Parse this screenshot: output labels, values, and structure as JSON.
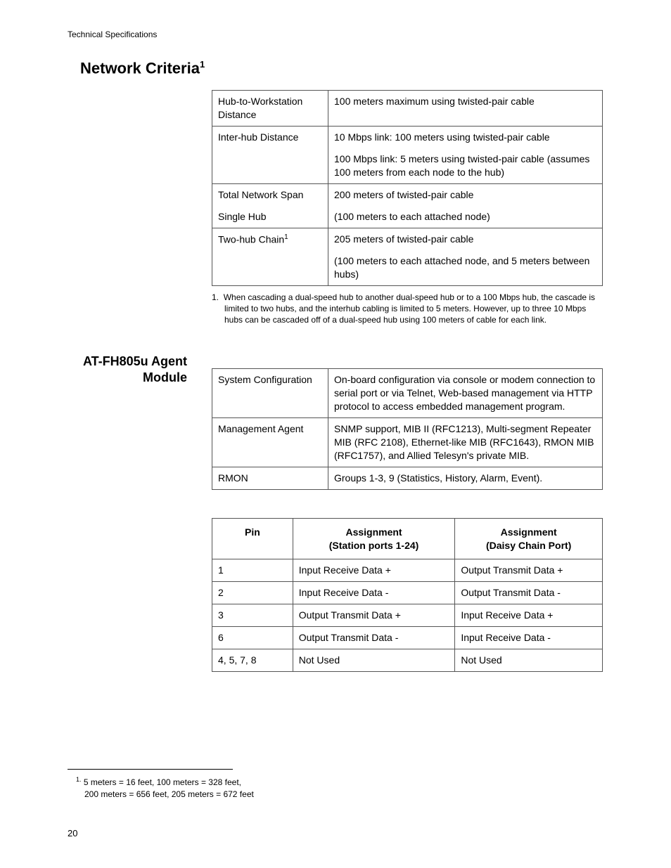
{
  "header": "Technical Specifications",
  "section1": {
    "title": "Network Criteria",
    "title_sup": "1"
  },
  "table1": {
    "rows": [
      {
        "label": "Hub-to-Workstation Distance",
        "value": "100 meters maximum using twisted-pair cable"
      },
      {
        "label": "Inter-hub Distance",
        "value": "10 Mbps link: 100 meters using twisted-pair cable"
      },
      {
        "label": "",
        "value": "100 Mbps link: 5 meters using twisted-pair cable (assumes 100 meters from each node to the hub)"
      },
      {
        "label": "Total Network Span",
        "value": "200 meters of twisted-pair cable"
      },
      {
        "label": "Single Hub",
        "value": "(100 meters to each attached node)"
      },
      {
        "label": "Two-hub Chain",
        "label_sup": "1",
        "value": "205 meters of twisted-pair cable"
      },
      {
        "label": "",
        "value": "(100 meters to each attached node, and 5 meters between hubs)"
      }
    ],
    "note_num": "1.",
    "note": "When cascading a dual-speed hub to another dual-speed hub or to a 100 Mbps hub, the cascade is limited to two hubs, and the interhub cabling is limited to 5 meters. However, up to three 10 Mbps hubs can be cascaded off of a dual-speed hub using 100 meters of cable for each link."
  },
  "section2": {
    "title_line1": "AT-FH805u Agent",
    "title_line2": "Module"
  },
  "table2": {
    "rows": [
      {
        "label": "System Configuration",
        "value": "On-board configuration via console or modem connection to serial port or via Telnet, Web-based management via HTTP protocol to access embedded management program."
      },
      {
        "label": "Management Agent",
        "value": "SNMP support, MIB II (RFC1213), Multi-segment Repeater MIB (RFC 2108), Ethernet-like MIB (RFC1643), RMON MIB (RFC1757), and Allied Telesyn's private MIB."
      },
      {
        "label": "RMON",
        "value": "Groups 1-3, 9 (Statistics, History, Alarm, Event)."
      }
    ]
  },
  "pin_table": {
    "headers": {
      "pin": "Pin",
      "a1_l1": "Assignment",
      "a1_l2": "(Station ports 1-24)",
      "a2_l1": "Assignment",
      "a2_l2": "(Daisy Chain Port)"
    },
    "rows": [
      {
        "pin": "1",
        "a1": "Input Receive Data +",
        "a2": "Output Transmit Data +"
      },
      {
        "pin": "2",
        "a1": "Input Receive Data -",
        "a2": "Output Transmit Data -"
      },
      {
        "pin": "3",
        "a1": "Output Transmit Data +",
        "a2": "Input Receive Data +"
      },
      {
        "pin": "6",
        "a1": "Output Transmit Data -",
        "a2": "Input Receive Data -"
      },
      {
        "pin": "4, 5, 7, 8",
        "a1": "Not Used",
        "a2": "Not Used"
      }
    ]
  },
  "footnote": {
    "sup": "1.",
    "line1": "5 meters = 16 feet, 100 meters = 328 feet,",
    "line2": "200 meters = 656 feet, 205 meters = 672 feet"
  },
  "page_number": "20"
}
